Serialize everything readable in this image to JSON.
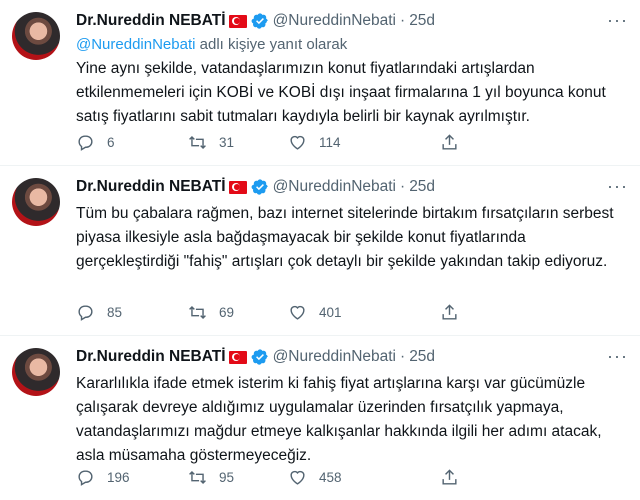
{
  "tweets": [
    {
      "name": "Dr.Nureddin NEBATİ",
      "handle": "@NureddinNebati",
      "separator": "·",
      "time": "25d",
      "reply_mention": "@NureddinNebati",
      "reply_suffix": "adlı kişiye yanıt olarak",
      "text": "Yine aynı şekilde, vatandaşlarımızın konut fiyatlarındaki artışlardan etkilenmemeleri için KOBİ ve KOBİ dışı inşaat firmalarına 1 yıl boyunca konut satış fiyatlarını sabit tutmaları kaydıyla belirli bir kaynak ayrılmıştır.",
      "replies": "6",
      "retweets": "31",
      "likes": "114"
    },
    {
      "name": "Dr.Nureddin NEBATİ",
      "handle": "@NureddinNebati",
      "separator": "·",
      "time": "25d",
      "text": "Tüm bu çabalara rağmen, bazı internet sitelerinde birtakım fırsatçıların serbest piyasa ilkesiyle asla bağdaşmayacak bir şekilde konut fiyatlarında gerçekleştirdiği \"fahiş\" artışları çok detaylı bir şekilde yakından takip ediyoruz.",
      "replies": "85",
      "retweets": "69",
      "likes": "401"
    },
    {
      "name": "Dr.Nureddin NEBATİ",
      "handle": "@NureddinNebati",
      "separator": "·",
      "time": "25d",
      "text": "Kararlılıkla ifade etmek isterim ki fahiş fiyat artışlarına karşı var gücümüzle çalışarak devreye aldığımız uygulamalar üzerinden fırsatçılık yapmaya, vatandaşlarımızı mağdur etmeye kalkışanlar hakkında ilgili her adımı atacak, asla müsamaha göstermeyeceğiz.",
      "replies": "196",
      "retweets": "95",
      "likes": "458"
    }
  ],
  "icons": {
    "avatar": "profile-photo",
    "flag": "turkey-flag-icon",
    "verified": "verified-badge-icon",
    "more": "more-options-icon",
    "reply": "reply-icon",
    "retweet": "retweet-icon",
    "like": "heart-icon",
    "share": "share-icon"
  },
  "colors": {
    "text": "#0f1419",
    "secondary": "#536471",
    "link": "#1d9bf0",
    "verified": "#1d9bf0",
    "flag": "#e30a17"
  }
}
